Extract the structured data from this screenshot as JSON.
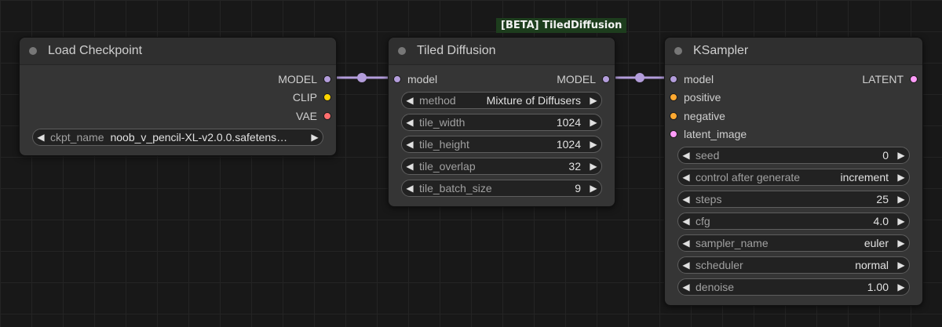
{
  "colors": {
    "model_slot": "#b39ddb",
    "clip_slot": "#ffd500",
    "vae_slot": "#ff6e6e",
    "conditioning_slot": "#ffa931",
    "latent_slot": "#ff9cf9",
    "link": "#b39ddb",
    "badge_bg": "#1d3d1d"
  },
  "badge": {
    "label": "[BETA] TiledDiffusion"
  },
  "load_checkpoint": {
    "title": "Load Checkpoint",
    "outputs": [
      {
        "label": "MODEL",
        "slot": "model"
      },
      {
        "label": "CLIP",
        "slot": "clip"
      },
      {
        "label": "VAE",
        "slot": "vae"
      }
    ],
    "widgets": [
      {
        "name": "ckpt_name",
        "value": "noob_v_pencil-XL-v2.0.0.safetens…"
      }
    ]
  },
  "tiled_diffusion": {
    "title": "Tiled Diffusion",
    "input": {
      "label": "model"
    },
    "output": {
      "label": "MODEL"
    },
    "widgets": [
      {
        "name": "method",
        "value": "Mixture of Diffusers"
      },
      {
        "name": "tile_width",
        "value": "1024"
      },
      {
        "name": "tile_height",
        "value": "1024"
      },
      {
        "name": "tile_overlap",
        "value": "32"
      },
      {
        "name": "tile_batch_size",
        "value": "9"
      }
    ]
  },
  "ksampler": {
    "title": "KSampler",
    "inputs": [
      {
        "label": "model",
        "slot": "model"
      },
      {
        "label": "positive",
        "slot": "conditioning"
      },
      {
        "label": "negative",
        "slot": "conditioning"
      },
      {
        "label": "latent_image",
        "slot": "latent"
      }
    ],
    "output": {
      "label": "LATENT"
    },
    "widgets": [
      {
        "name": "seed",
        "value": "0"
      },
      {
        "name": "control after generate",
        "value": "increment"
      },
      {
        "name": "steps",
        "value": "25"
      },
      {
        "name": "cfg",
        "value": "4.0"
      },
      {
        "name": "sampler_name",
        "value": "euler"
      },
      {
        "name": "scheduler",
        "value": "normal"
      },
      {
        "name": "denoise",
        "value": "1.00"
      }
    ]
  }
}
